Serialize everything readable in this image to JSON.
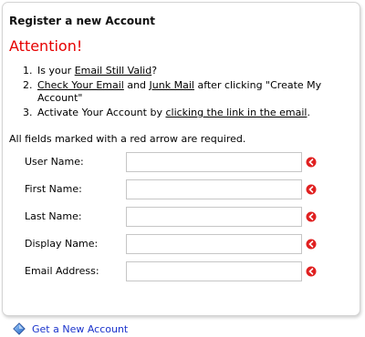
{
  "panel": {
    "title": "Register a new Account",
    "attention": "Attention!",
    "steps": [
      {
        "num": "1.",
        "pre": "Is your ",
        "link": "Email Still Valid",
        "post": "?"
      },
      {
        "num": "2.",
        "link1": "Check Your Email",
        "mid": " and ",
        "link2": "Junk Mail",
        "post": " after clicking \"Create My Account\""
      },
      {
        "num": "3.",
        "pre": "Activate Your Account by ",
        "link": "clicking the link in the email",
        "post": "."
      }
    ],
    "required_note": "All fields marked with a red arrow are required."
  },
  "form": {
    "fields": [
      {
        "label": "User Name:",
        "value": ""
      },
      {
        "label": "First Name:",
        "value": ""
      },
      {
        "label": "Last Name:",
        "value": ""
      },
      {
        "label": "Display Name:",
        "value": ""
      },
      {
        "label": "Email Address:",
        "value": ""
      }
    ]
  },
  "footer": {
    "link_label": "Get a New Account"
  },
  "colors": {
    "attention": "#e60000",
    "required_icon": "#e02020",
    "link": "#1a33cc"
  },
  "icons": {
    "required": "required-arrow-icon",
    "footer": "diamond-icon"
  }
}
